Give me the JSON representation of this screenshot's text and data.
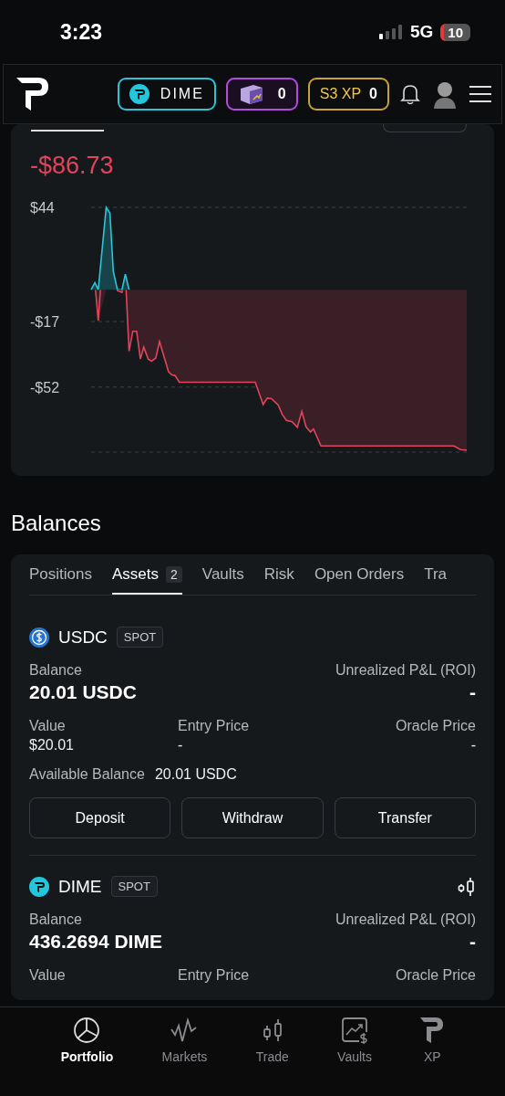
{
  "status_bar": {
    "time": "3:23",
    "network": "5G",
    "battery": "10"
  },
  "header": {
    "brand_pill": {
      "label": "DIME"
    },
    "chest_pill": {
      "count": "0"
    },
    "xp_pill": {
      "label": "S3 XP",
      "count": "0"
    }
  },
  "pnl_card": {
    "value": "-$86.73",
    "y_labels": [
      "$44",
      "-$17",
      "-$52"
    ]
  },
  "balances": {
    "title": "Balances",
    "tabs": [
      {
        "label": "Positions",
        "selected": false
      },
      {
        "label": "Assets",
        "badge": "2",
        "selected": true
      },
      {
        "label": "Vaults",
        "selected": false
      },
      {
        "label": "Risk",
        "selected": false
      },
      {
        "label": "Open Orders",
        "selected": false
      },
      {
        "label": "Tra",
        "selected": false
      }
    ],
    "assets": [
      {
        "kind": "usdc",
        "symbol": "USDC",
        "tag": "SPOT",
        "chart_button": false,
        "balance_label": "Balance",
        "balance": "20.01 USDC",
        "pnl_label": "Unrealized P&L (ROI)",
        "pnl": "-",
        "fields": [
          {
            "label": "Value",
            "value": "$20.01"
          },
          {
            "label": "Entry Price",
            "value": "-"
          },
          {
            "label": "Oracle Price",
            "value": "-"
          }
        ],
        "available_label": "Available Balance",
        "available": "20.01 USDC",
        "actions": [
          "Deposit",
          "Withdraw",
          "Transfer"
        ]
      },
      {
        "kind": "dime",
        "symbol": "DIME",
        "tag": "SPOT",
        "chart_button": true,
        "balance_label": "Balance",
        "balance": "436.2694 DIME",
        "pnl_label": "Unrealized P&L (ROI)",
        "pnl": "-",
        "fields": [
          {
            "label": "Value"
          },
          {
            "label": "Entry Price"
          },
          {
            "label": "Oracle Price"
          }
        ]
      }
    ]
  },
  "nav": [
    {
      "kind": "portfolio",
      "label": "Portfolio",
      "selected": true
    },
    {
      "kind": "markets",
      "label": "Markets",
      "selected": false
    },
    {
      "kind": "trade",
      "label": "Trade",
      "selected": false
    },
    {
      "kind": "vaults",
      "label": "Vaults",
      "selected": false
    },
    {
      "kind": "xp",
      "label": "XP",
      "selected": false
    }
  ]
}
